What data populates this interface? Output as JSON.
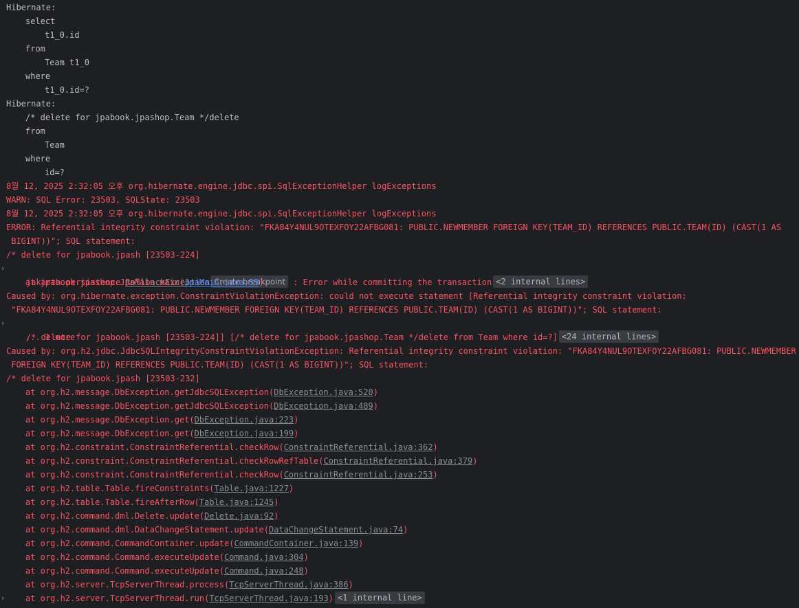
{
  "console": {
    "hibernate_label": "Hibernate:",
    "q1": {
      "select": "select",
      "col": "t1_0.id",
      "from": "from",
      "table": "Team t1_0",
      "where": "where",
      "cond": "t1_0.id=?"
    },
    "q2": {
      "comment": "/* delete for jpabook.jpashop.Team */delete",
      "from": "from",
      "table": "Team",
      "where": "where",
      "cond": "id=?"
    },
    "log1_header": "8월 12, 2025 2:32:05 오후 org.hibernate.engine.jdbc.spi.SqlExceptionHelper logExceptions",
    "log1_msg": "WARN: SQL Error: 23503, SQLState: 23503",
    "log2_header": "8월 12, 2025 2:32:05 오후 org.hibernate.engine.jdbc.spi.SqlExceptionHelper logExceptions",
    "log2_msg_1": "ERROR: Referential integrity constraint violation: \"FKA84Y4NUL9OTEXFOY22AFBG081: PUBLIC.NEWMEMBER FOREIGN KEY(TEAM_ID) REFERENCES PUBLIC.TEAM(ID) (CAST(1 AS",
    "log2_msg_2": " BIGINT))\"; SQL statement:",
    "log2_msg_3": "/* delete for jpabook.jpash [23503-224]",
    "exc1": {
      "pkg": "jakarta.persistence.",
      "cls": "RollbackException",
      "breakpoint": "Create breakpoint",
      "msg": " : Error while committing the transaction",
      "internal": "<2 internal lines>"
    },
    "at_main": {
      "prefix": "at jpabook.jpashop.JpaMain.main(",
      "link": "JpaMain.java:55",
      "suffix": ")"
    },
    "caused1_1": "Caused by: org.hibernate.exception.ConstraintViolationException: could not execute statement [Referential integrity constraint violation:",
    "caused1_2": " \"FKA84Y4NUL9OTEXFOY22AFBG081: PUBLIC.NEWMEMBER FOREIGN KEY(TEAM_ID) REFERENCES PUBLIC.TEAM(ID) (CAST(1 AS BIGINT))\"; SQL statement:",
    "caused1_3": "/* delete for jpabook.jpash [23503-224]] [/* delete for jpabook.jpashop.Team */delete from Team where id=?]",
    "caused1_internal": "<24 internal lines>",
    "more": "... 1 more",
    "caused2_1": "Caused by: org.h2.jdbc.JdbcSQLIntegrityConstraintViolationException: Referential integrity constraint violation: \"FKA84Y4NUL9OTEXFOY22AFBG081: PUBLIC.NEWMEMBER",
    "caused2_2": " FOREIGN KEY(TEAM_ID) REFERENCES PUBLIC.TEAM(ID) (CAST(1 AS BIGINT))\"; SQL statement:",
    "caused2_3": "/* delete for jpabook.jpash [23503-232]",
    "stack": [
      {
        "prefix": "at org.h2.message.DbException.getJdbcSQLException(",
        "link": "DbException.java:520"
      },
      {
        "prefix": "at org.h2.message.DbException.getJdbcSQLException(",
        "link": "DbException.java:489"
      },
      {
        "prefix": "at org.h2.message.DbException.get(",
        "link": "DbException.java:223"
      },
      {
        "prefix": "at org.h2.message.DbException.get(",
        "link": "DbException.java:199"
      },
      {
        "prefix": "at org.h2.constraint.ConstraintReferential.checkRow(",
        "link": "ConstraintReferential.java:362"
      },
      {
        "prefix": "at org.h2.constraint.ConstraintReferential.checkRowRefTable(",
        "link": "ConstraintReferential.java:379"
      },
      {
        "prefix": "at org.h2.constraint.ConstraintReferential.checkRow(",
        "link": "ConstraintReferential.java:253"
      },
      {
        "prefix": "at org.h2.table.Table.fireConstraints(",
        "link": "Table.java:1227"
      },
      {
        "prefix": "at org.h2.table.Table.fireAfterRow(",
        "link": "Table.java:1245"
      },
      {
        "prefix": "at org.h2.command.dml.Delete.update(",
        "link": "Delete.java:92"
      },
      {
        "prefix": "at org.h2.command.dml.DataChangeStatement.update(",
        "link": "DataChangeStatement.java:74"
      },
      {
        "prefix": "at org.h2.command.CommandContainer.update(",
        "link": "CommandContainer.java:139"
      },
      {
        "prefix": "at org.h2.command.Command.executeUpdate(",
        "link": "Command.java:304"
      },
      {
        "prefix": "at org.h2.command.Command.executeUpdate(",
        "link": "Command.java:248"
      },
      {
        "prefix": "at org.h2.server.TcpServerThread.process(",
        "link": "TcpServerThread.java:386"
      },
      {
        "prefix": "at org.h2.server.TcpServerThread.run(",
        "link": "TcpServerThread.java:193"
      }
    ],
    "last_internal": "<1 internal line>",
    "close_paren": ")",
    "expand_glyph": "›"
  },
  "colors": {
    "background": "#1e1f22",
    "normal_text": "#bcbec4",
    "error_text": "#f75464",
    "link_blue": "#548af7",
    "link_gray": "#8a8d93",
    "pill_bg": "#393b40"
  },
  "icons": {
    "expand": "chevron-right-icon"
  }
}
